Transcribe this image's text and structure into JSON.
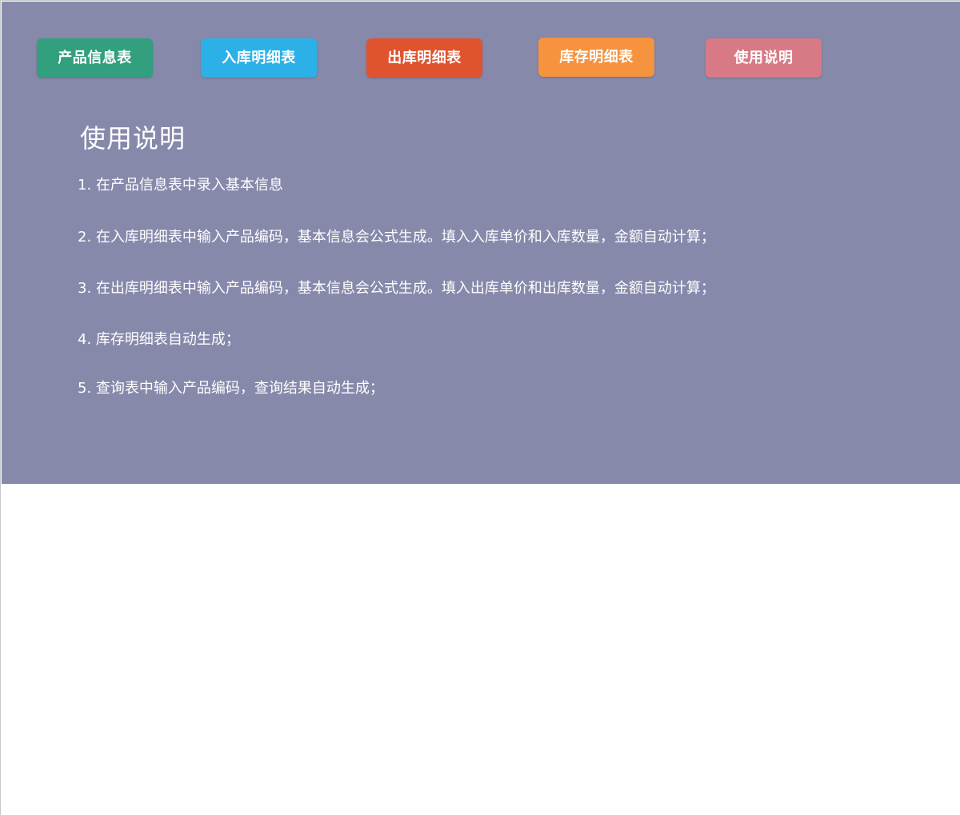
{
  "nav": {
    "tabs": [
      {
        "label": "产品信息表",
        "color": "#329f7e"
      },
      {
        "label": "入库明细表",
        "color": "#2bb1e7"
      },
      {
        "label": "出库明细表",
        "color": "#e0532f"
      },
      {
        "label": "库存明细表",
        "color": "#f5933f"
      },
      {
        "label": "使用说明",
        "color": "#d77a85"
      }
    ]
  },
  "content": {
    "background_color": "#8789ab",
    "title": "使用说明",
    "steps": [
      "1. 在产品信息表中录入基本信息",
      "2. 在入库明细表中输入产品编码，基本信息会公式生成。填入入库单价和入库数量，金额自动计算；",
      "3. 在出库明细表中输入产品编码，基本信息会公式生成。填入出库单价和出库数量，金额自动计算；",
      "4. 库存明细表自动生成；",
      "5. 查询表中输入产品编码，查询结果自动生成；"
    ]
  }
}
